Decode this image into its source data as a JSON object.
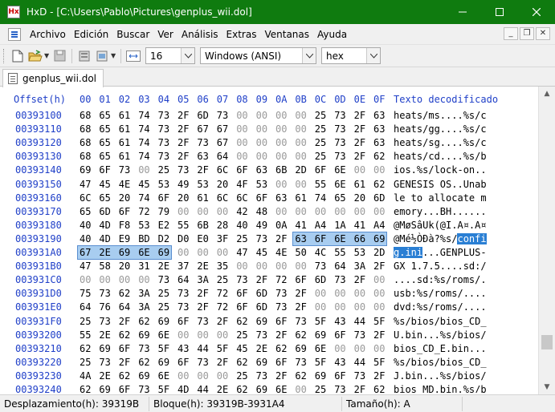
{
  "window": {
    "app_name": "HxD",
    "title": "HxD - [C:\\Users\\Pablo\\Pictures\\genplus_wii.dol]",
    "minimize": "—",
    "maximize": "☐",
    "close": "✕",
    "titlebar_color": "#0f7b0f"
  },
  "menu": {
    "items": [
      "Archivo",
      "Edición",
      "Buscar",
      "Ver",
      "Análisis",
      "Extras",
      "Ventanas",
      "Ayuda"
    ]
  },
  "toolbar": {
    "bytes_per_row": "16",
    "charset": "Windows (ANSI)",
    "offset_base": "hex"
  },
  "tab": {
    "label": "genplus_wii.dol"
  },
  "hex": {
    "header": {
      "offset_label": "Offset(h)",
      "columns": [
        "00",
        "01",
        "02",
        "03",
        "04",
        "05",
        "06",
        "07",
        "08",
        "09",
        "0A",
        "0B",
        "0C",
        "0D",
        "0E",
        "0F"
      ],
      "text_label": "Texto decodificado"
    },
    "rows": [
      {
        "offset": "00393100",
        "bytes": [
          "68",
          "65",
          "61",
          "74",
          "73",
          "2F",
          "6D",
          "73",
          "00",
          "00",
          "00",
          "00",
          "25",
          "73",
          "2F",
          "63"
        ],
        "text": "heats/ms....%s/c"
      },
      {
        "offset": "00393110",
        "bytes": [
          "68",
          "65",
          "61",
          "74",
          "73",
          "2F",
          "67",
          "67",
          "00",
          "00",
          "00",
          "00",
          "25",
          "73",
          "2F",
          "63"
        ],
        "text": "heats/gg....%s/c"
      },
      {
        "offset": "00393120",
        "bytes": [
          "68",
          "65",
          "61",
          "74",
          "73",
          "2F",
          "73",
          "67",
          "00",
          "00",
          "00",
          "00",
          "25",
          "73",
          "2F",
          "63"
        ],
        "text": "heats/sg....%s/c"
      },
      {
        "offset": "00393130",
        "bytes": [
          "68",
          "65",
          "61",
          "74",
          "73",
          "2F",
          "63",
          "64",
          "00",
          "00",
          "00",
          "00",
          "25",
          "73",
          "2F",
          "62"
        ],
        "text": "heats/cd....%s/b"
      },
      {
        "offset": "00393140",
        "bytes": [
          "69",
          "6F",
          "73",
          "00",
          "25",
          "73",
          "2F",
          "6C",
          "6F",
          "63",
          "6B",
          "2D",
          "6F",
          "6E",
          "00",
          "00"
        ],
        "text": "ios.%s/lock-on.."
      },
      {
        "offset": "00393150",
        "bytes": [
          "47",
          "45",
          "4E",
          "45",
          "53",
          "49",
          "53",
          "20",
          "4F",
          "53",
          "00",
          "00",
          "55",
          "6E",
          "61",
          "62"
        ],
        "text": "GENESIS OS..Unab"
      },
      {
        "offset": "00393160",
        "bytes": [
          "6C",
          "65",
          "20",
          "74",
          "6F",
          "20",
          "61",
          "6C",
          "6C",
          "6F",
          "63",
          "61",
          "74",
          "65",
          "20",
          "6D"
        ],
        "text": "le to allocate m"
      },
      {
        "offset": "00393170",
        "bytes": [
          "65",
          "6D",
          "6F",
          "72",
          "79",
          "00",
          "00",
          "00",
          "42",
          "48",
          "00",
          "00",
          "00",
          "00",
          "00",
          "00"
        ],
        "text": "emory...BH......"
      },
      {
        "offset": "00393180",
        "bytes": [
          "40",
          "4D",
          "F8",
          "53",
          "E2",
          "55",
          "6B",
          "28",
          "40",
          "49",
          "0A",
          "41",
          "A4",
          "1A",
          "41",
          "A4"
        ],
        "text": "@MøSâUk(@I.A¤.A¤"
      },
      {
        "offset": "00393190",
        "bytes": [
          "40",
          "4D",
          "E9",
          "BD",
          "D2",
          "D0",
          "E0",
          "3F",
          "25",
          "73",
          "2F",
          "63",
          "6F",
          "6E",
          "66",
          "69"
        ],
        "text": "@Mé½ÒÐà?%s/confi"
      },
      {
        "offset": "003931A0",
        "bytes": [
          "67",
          "2E",
          "69",
          "6E",
          "69",
          "00",
          "00",
          "00",
          "47",
          "45",
          "4E",
          "50",
          "4C",
          "55",
          "53",
          "2D"
        ],
        "text": "g.ini...GENPLUS-"
      },
      {
        "offset": "003931B0",
        "bytes": [
          "47",
          "58",
          "20",
          "31",
          "2E",
          "37",
          "2E",
          "35",
          "00",
          "00",
          "00",
          "00",
          "73",
          "64",
          "3A",
          "2F"
        ],
        "text": "GX 1.7.5....sd:/"
      },
      {
        "offset": "003931C0",
        "bytes": [
          "00",
          "00",
          "00",
          "00",
          "73",
          "64",
          "3A",
          "25",
          "73",
          "2F",
          "72",
          "6F",
          "6D",
          "73",
          "2F",
          "00"
        ],
        "text": "....sd:%s/roms/."
      },
      {
        "offset": "003931D0",
        "bytes": [
          "75",
          "73",
          "62",
          "3A",
          "25",
          "73",
          "2F",
          "72",
          "6F",
          "6D",
          "73",
          "2F",
          "00",
          "00",
          "00",
          "00"
        ],
        "text": "usb:%s/roms/...."
      },
      {
        "offset": "003931E0",
        "bytes": [
          "64",
          "76",
          "64",
          "3A",
          "25",
          "73",
          "2F",
          "72",
          "6F",
          "6D",
          "73",
          "2F",
          "00",
          "00",
          "00",
          "00"
        ],
        "text": "dvd:%s/roms/...."
      },
      {
        "offset": "003931F0",
        "bytes": [
          "25",
          "73",
          "2F",
          "62",
          "69",
          "6F",
          "73",
          "2F",
          "62",
          "69",
          "6F",
          "73",
          "5F",
          "43",
          "44",
          "5F"
        ],
        "text": "%s/bios/bios_CD_"
      },
      {
        "offset": "00393200",
        "bytes": [
          "55",
          "2E",
          "62",
          "69",
          "6E",
          "00",
          "00",
          "00",
          "25",
          "73",
          "2F",
          "62",
          "69",
          "6F",
          "73",
          "2F"
        ],
        "text": "U.bin...%s/bios/"
      },
      {
        "offset": "00393210",
        "bytes": [
          "62",
          "69",
          "6F",
          "73",
          "5F",
          "43",
          "44",
          "5F",
          "45",
          "2E",
          "62",
          "69",
          "6E",
          "00",
          "00",
          "00"
        ],
        "text": "bios_CD_E.bin..."
      },
      {
        "offset": "00393220",
        "bytes": [
          "25",
          "73",
          "2F",
          "62",
          "69",
          "6F",
          "73",
          "2F",
          "62",
          "69",
          "6F",
          "73",
          "5F",
          "43",
          "44",
          "5F"
        ],
        "text": "%s/bios/bios_CD_"
      },
      {
        "offset": "00393230",
        "bytes": [
          "4A",
          "2E",
          "62",
          "69",
          "6E",
          "00",
          "00",
          "00",
          "25",
          "73",
          "2F",
          "62",
          "69",
          "6F",
          "73",
          "2F"
        ],
        "text": "J.bin...%s/bios/"
      },
      {
        "offset": "00393240",
        "bytes": [
          "62",
          "69",
          "6F",
          "73",
          "5F",
          "4D",
          "44",
          "2E",
          "62",
          "69",
          "6E",
          "00",
          "25",
          "73",
          "2F",
          "62"
        ],
        "text": "bios_MD.bin.%s/b"
      },
      {
        "offset": "00393250",
        "bytes": [
          "69",
          "6F",
          "73",
          "2F",
          "62",
          "69",
          "6F",
          "73",
          "5F",
          "55",
          "2E",
          "73",
          "6D",
          "73",
          "00",
          "00"
        ],
        "text": "ios/bios_U.sms.."
      }
    ],
    "selection": [
      {
        "row": 9,
        "from": 11,
        "to": 15
      },
      {
        "row": 10,
        "from": 0,
        "to": 4
      }
    ]
  },
  "status": {
    "offset": "Desplazamiento(h): 39319B",
    "block": "Bloque(h): 39319B-3931A4",
    "size": "Tamaño(h): A"
  },
  "colors": {
    "offset_blue": "#1f3fc8",
    "selection_hex": "#a8cdf0",
    "selection_text": "#2a7fd4"
  }
}
